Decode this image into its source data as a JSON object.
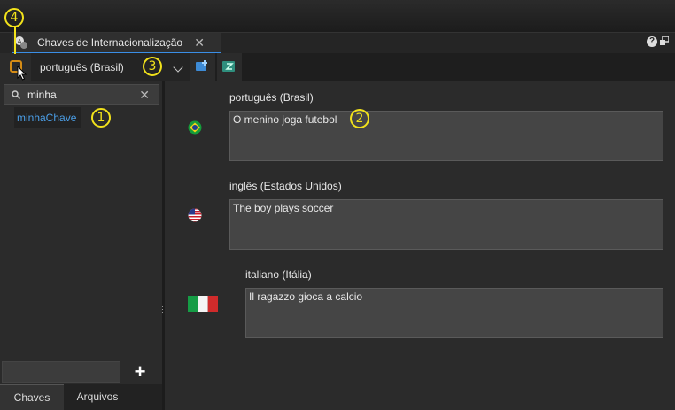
{
  "tab": {
    "title": "Chaves de Internacionalização",
    "close": "✕",
    "help": "?"
  },
  "toolbar": {
    "language": "português (Brasil)"
  },
  "sidebar": {
    "search_value": "minha",
    "search_clear": "✕",
    "keys": [
      "minhaChave"
    ],
    "add_label": "+",
    "tabs": [
      "Chaves",
      "Arquivos"
    ]
  },
  "translations": [
    {
      "language": "português (Brasil)",
      "text": "O menino joga futebol",
      "flag": "brazil-flag-icon"
    },
    {
      "language": "inglês (Estados Unidos)",
      "text": "The boy plays soccer",
      "flag": "usa-flag-icon"
    },
    {
      "language": "italiano (Itália)",
      "text": "Il ragazzo gioca a calcio",
      "flag": "italy-flag-icon"
    }
  ],
  "annotations": [
    "1",
    "2",
    "3",
    "4"
  ],
  "colors": {
    "accent": "#3a8ee6",
    "annotation": "#f2e21b",
    "key_link": "#4b9fe8"
  }
}
